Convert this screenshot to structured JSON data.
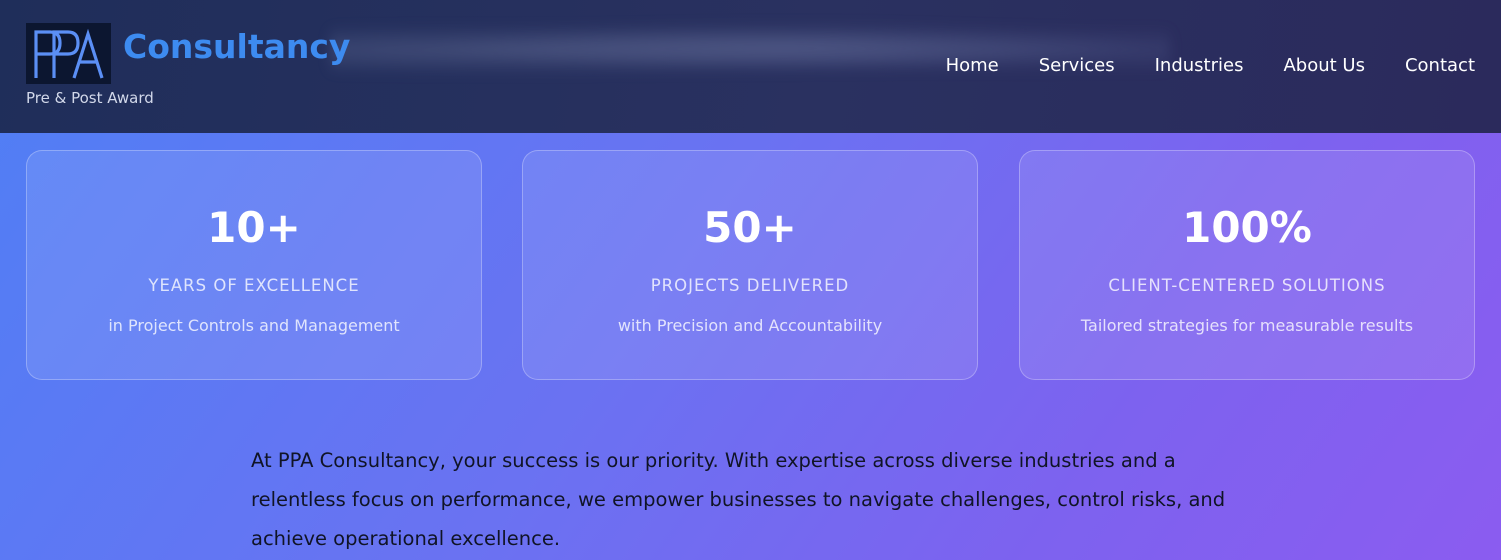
{
  "brand": {
    "logo_text": "PPA",
    "name": "Consultancy",
    "tagline": "Pre & Post Award",
    "color": "#3d8bf0"
  },
  "nav": {
    "items": [
      {
        "label": "Home"
      },
      {
        "label": "Services"
      },
      {
        "label": "Industries"
      },
      {
        "label": "About Us"
      },
      {
        "label": "Contact"
      }
    ]
  },
  "stats": [
    {
      "value": "10+",
      "label": "YEARS OF EXCELLENCE",
      "description": "in Project Controls and Management"
    },
    {
      "value": "50+",
      "label": "PROJECTS DELIVERED",
      "description": "with Precision and Accountability"
    },
    {
      "value": "100%",
      "label": "CLIENT-CENTERED SOLUTIONS",
      "description": "Tailored strategies for measurable results"
    }
  ],
  "intro": {
    "text": "At PPA Consultancy, your success is our priority. With expertise across diverse industries and a relentless focus on performance, we empower businesses to navigate challenges, control risks, and achieve operational excellence."
  }
}
